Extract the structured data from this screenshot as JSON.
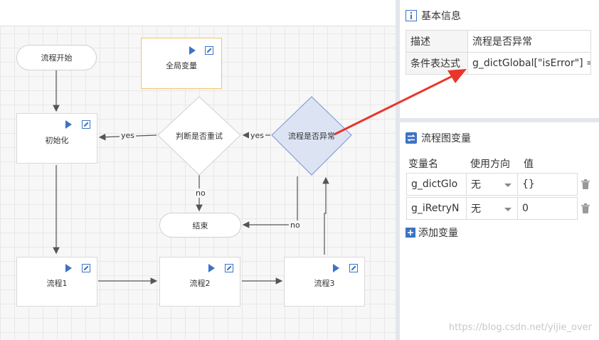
{
  "flow": {
    "start": "流程开始",
    "global_vars": "全局变量",
    "init": "初始化",
    "retry_decision": "判断是否重试",
    "error_decision": "流程是否异常",
    "end": "结束",
    "step1": "流程1",
    "step2": "流程2",
    "step3": "流程3",
    "yes": "yes",
    "no": "no"
  },
  "basic_info": {
    "title": "基本信息",
    "rows": [
      {
        "key": "描述",
        "value": "流程是否异常"
      },
      {
        "key": "条件表达式",
        "value": "g_dictGlobal[\"isError\"] =="
      }
    ]
  },
  "variables": {
    "title": "流程图变量",
    "headers": {
      "name": "变量名",
      "direction": "使用方向",
      "value": "值"
    },
    "rows": [
      {
        "name": "g_dictGlo",
        "direction": "无",
        "value": "{}"
      },
      {
        "name": "g_iRetryN",
        "direction": "无",
        "value": "0"
      }
    ],
    "add_label": "添加变量"
  },
  "colors": {
    "accent": "#3c73c4",
    "highlight_fill": "#dce4f4",
    "highlight_border": "#7a96d0",
    "global_border": "#f2c46e",
    "annotation_arrow": "#e8372a"
  },
  "watermark": "https://blog.csdn.net/yijie_over"
}
